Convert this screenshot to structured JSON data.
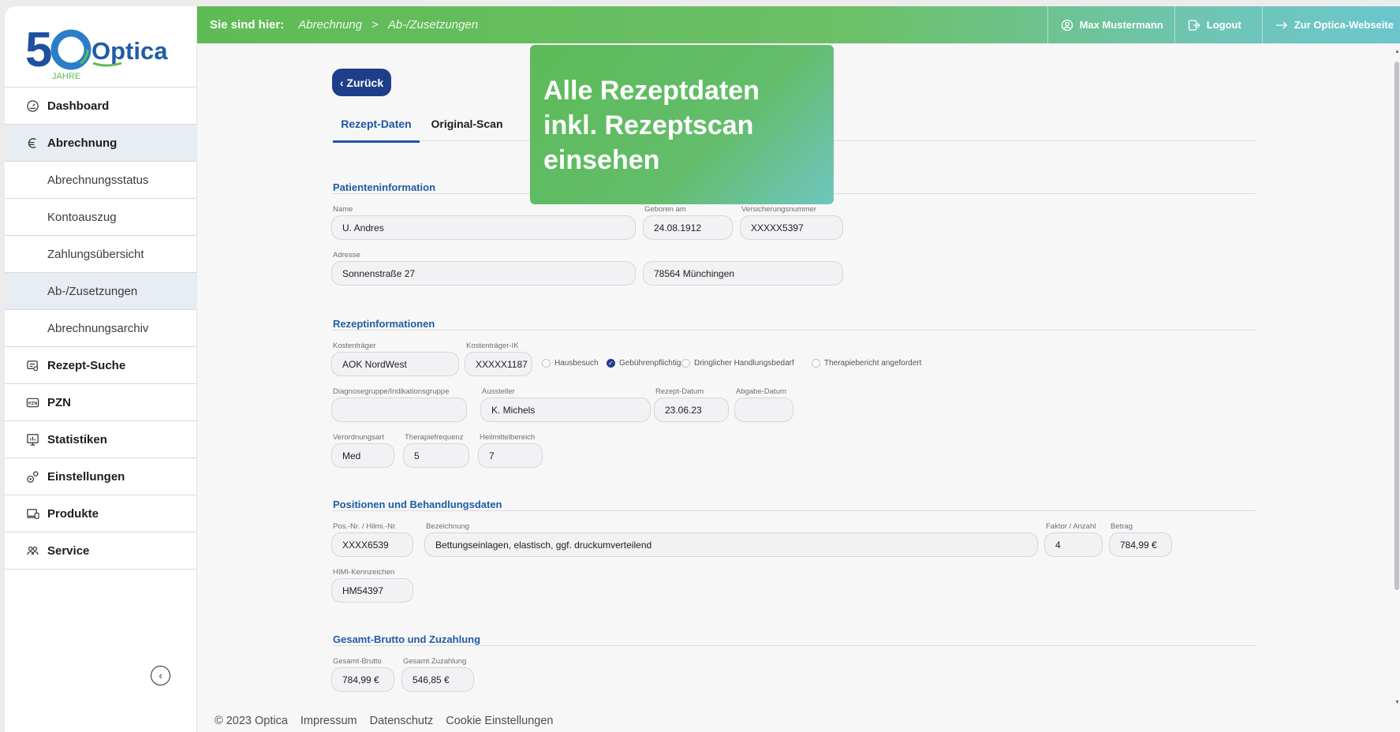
{
  "brand": {
    "logo_text": "Optica",
    "anniversary": "50",
    "anniversary_sub": "JAHRE"
  },
  "breadcrumb": {
    "lead": "Sie sind hier:",
    "items": [
      "Abrechnung",
      "Ab-/Zusetzungen"
    ],
    "separator": ">"
  },
  "top_actions": {
    "user": "Max Mustermann",
    "logout": "Logout",
    "website": "Zur Optica-Webseite"
  },
  "sidebar": {
    "items": [
      {
        "label": "Dashboard",
        "icon": "dashboard-gauge-icon"
      },
      {
        "label": "Abrechnung",
        "icon": "euro-icon"
      },
      {
        "label": "Abrechnungsstatus"
      },
      {
        "label": "Kontoauszug"
      },
      {
        "label": "Zahlungsübersicht"
      },
      {
        "label": "Ab-/Zusetzungen"
      },
      {
        "label": "Abrechnungsarchiv"
      },
      {
        "label": "Rezept-Suche",
        "icon": "prescription-search-icon"
      },
      {
        "label": "PZN",
        "icon": "pzn-icon"
      },
      {
        "label": "Statistiken",
        "icon": "statistics-icon"
      },
      {
        "label": "Einstellungen",
        "icon": "settings-gears-icon"
      },
      {
        "label": "Produkte",
        "icon": "products-icon"
      },
      {
        "label": "Service",
        "icon": "service-people-icon"
      }
    ],
    "collapse_icon": "‹"
  },
  "back_button": "‹ Zurück",
  "tabs": [
    "Rezept-Daten",
    "Original-Scan"
  ],
  "callout": {
    "line1": "Alle Rezeptdaten",
    "line2": "inkl. Rezeptscan",
    "line3": "einsehen"
  },
  "patient": {
    "title": "Patienteninformation",
    "name_label": "Name",
    "name": "U. Andres",
    "dob_label": "Geboren am",
    "dob": "24.08.1912",
    "insurance_no_label": "Versicherungsnummer",
    "insurance_no": "XXXXX5397",
    "address_label": "Adresse",
    "street": "Sonnenstraße 27",
    "city": "78564 Münchingen"
  },
  "prescription": {
    "title": "Rezeptinformationen",
    "payer_label": "Kostenträger",
    "payer": "AOK NordWest",
    "payer_ik_label": "Kostenträger-IK",
    "payer_ik": "XXXXX1187",
    "checks": [
      {
        "label": "Hausbesuch",
        "checked": false
      },
      {
        "label": "Gebührenpflichtig",
        "checked": true
      },
      {
        "label": "Dringlicher Handlungsbedarf",
        "checked": false
      },
      {
        "label": "Therapiebericht angefordert",
        "checked": false
      }
    ],
    "diagnosis_label": "Diagnosegruppe/Indikationsgruppe",
    "diagnosis": "",
    "issuer_label": "Aussteller",
    "issuer": "K. Michels",
    "rx_date_label": "Rezept-Datum",
    "rx_date": "23.06.23",
    "dispense_date_label": "Abgabe-Datum",
    "dispense_date": "",
    "order_type_label": "Verordnungsart",
    "order_type": "Med",
    "frequency_label": "Therapiefrequenz",
    "frequency": "5",
    "remedy_label": "Heilmittelbereich",
    "remedy": "7"
  },
  "positions": {
    "title": "Positionen und Behandlungsdaten",
    "pos_label": "Pos.-Nr. / Hilmi.-Nr.",
    "pos": "XXXX6539",
    "desc_label": "Bezeichnung",
    "desc": "Bettungseinlagen, elastisch, ggf. druckumverteilend",
    "factor_label": "Faktor / Anzahl",
    "factor": "4",
    "amount_label": "Betrag",
    "amount": "784,99 €",
    "himi_label": "HIMI-Kennzeichen",
    "himi": "HM54397"
  },
  "totals": {
    "title": "Gesamt-Brutto und Zuzahlung",
    "gross_label": "Gesamt-Brutto",
    "gross": "784,99 €",
    "copay_label": "Gesamt Zuzahlung",
    "copay": "546,85 €"
  },
  "footer": {
    "copyright": "© 2023 Optica",
    "links": [
      "Impressum",
      "Datenschutz",
      "Cookie Einstellungen"
    ]
  },
  "colors": {
    "accent_blue": "#1f3e8a",
    "section_blue": "#1f5ca5",
    "green": "#5fbb55",
    "teal": "#6bc6cd"
  }
}
